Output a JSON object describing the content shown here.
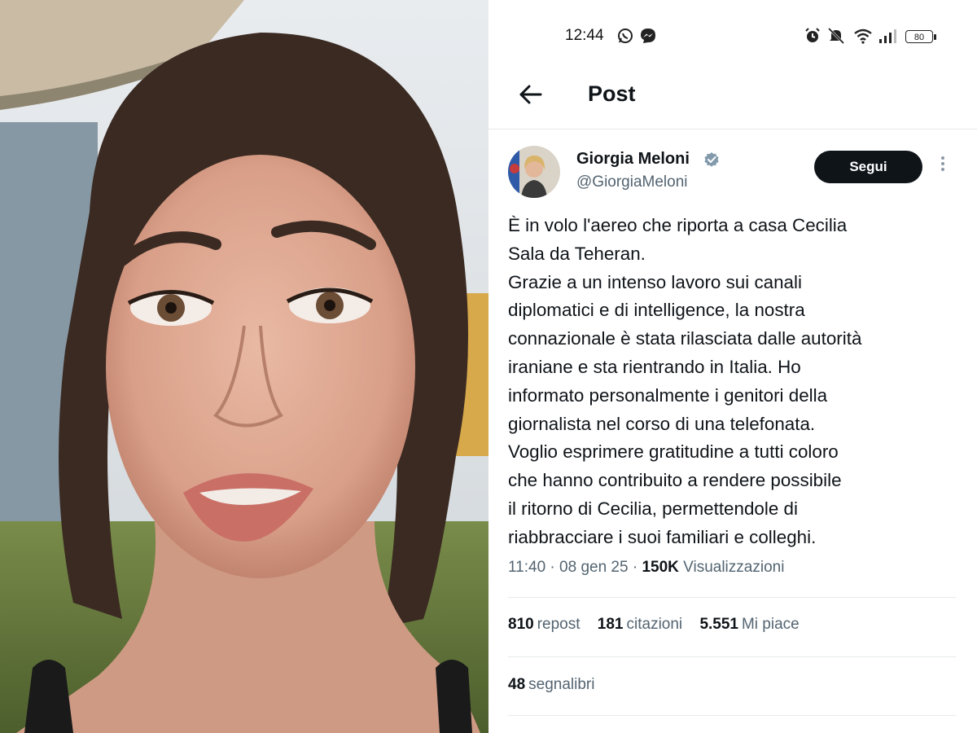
{
  "status_bar": {
    "time": "12:44",
    "battery": "80"
  },
  "header": {
    "title": "Post"
  },
  "post": {
    "author_name": "Giorgia Meloni",
    "author_handle": "@GiorgiaMeloni",
    "follow_label": "Segui",
    "text_lines": [
      "È in volo l'aereo che riporta a casa Cecilia",
      "Sala da Teheran.",
      "Grazie a un intenso lavoro sui canali",
      "diplomatici e di intelligence, la nostra",
      "connazionale è stata rilasciata dalle autorità",
      "iraniane e sta rientrando in Italia. Ho",
      "informato personalmente i genitori della",
      "giornalista nel corso di una telefonata.",
      "Voglio esprimere gratitudine a tutti coloro",
      "che hanno contribuito a rendere possibile",
      "il ritorno di Cecilia, permettendole di",
      "riabbracciare i suoi familiari e colleghi."
    ],
    "time": "11:40",
    "date": "08 gen 25",
    "views_count": "150K",
    "views_label": "Visualizzazioni",
    "separator": "·"
  },
  "stats": {
    "reposts_count": "810",
    "reposts_label": "repost",
    "quotes_count": "181",
    "quotes_label": "citazioni",
    "likes_count": "5.551",
    "likes_label": "Mi piace",
    "bookmarks_count": "48",
    "bookmarks_label": "segnalibri"
  },
  "colors": {
    "text_primary": "#0f1419",
    "text_secondary": "#536471",
    "follow_button_bg": "#0f1419",
    "verified_badge": "#829aab"
  },
  "icons": [
    "whatsapp-icon",
    "messenger-icon",
    "alarm-icon",
    "mute-icon",
    "wifi-icon",
    "signal-icon",
    "battery-icon",
    "back-arrow-icon",
    "verified-badge-icon",
    "more-options-icon"
  ]
}
